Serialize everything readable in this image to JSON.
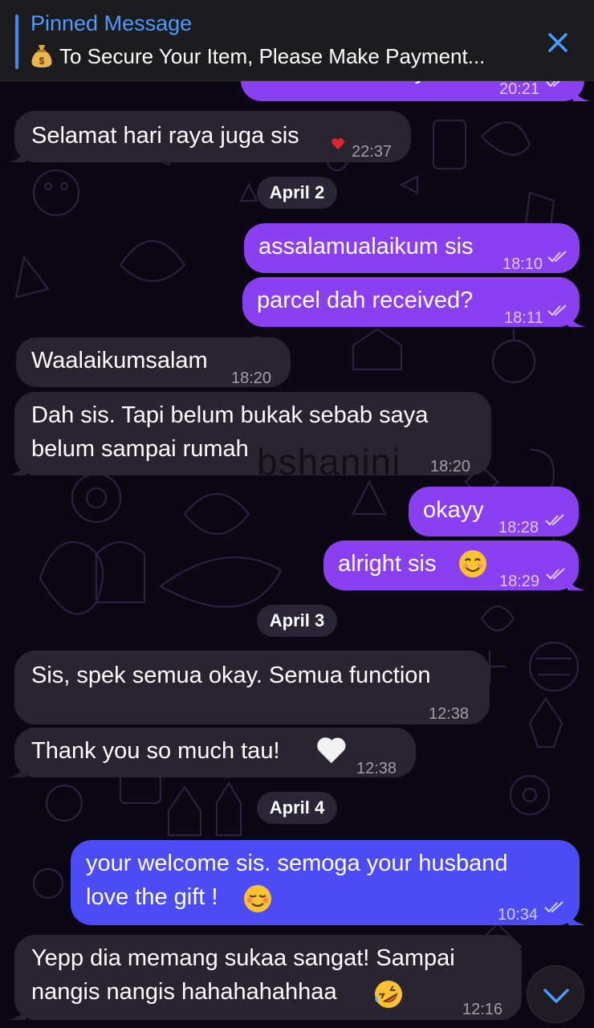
{
  "pinned": {
    "title": "Pinned Message",
    "text": "To Secure Your Item, Please Make Payment...",
    "icon": "money-bag-icon",
    "close_icon": "close-icon",
    "accent": "#4a9bff"
  },
  "colors": {
    "incoming": "#2a2430",
    "outgoing": "#8a3ff0",
    "outgoing_alt": "#4b4cf5",
    "background": "#0b0713"
  },
  "messages": {
    "m0": {
      "text": "Selamat hari raya",
      "time": "20:21"
    },
    "m1": {
      "text": "Selamat hari raya juga sis",
      "time": "22:37",
      "reaction": "heart"
    },
    "d1": "April 2",
    "m2": {
      "text": "assalamualaikum sis",
      "time": "18:10"
    },
    "m3": {
      "text": "parcel dah received?",
      "time": "18:11"
    },
    "m4": {
      "text": "Waalaikumsalam",
      "time": "18:20"
    },
    "m5": {
      "line1": "Dah sis. Tapi belum bukak sebab saya",
      "line2": "belum sampai rumah",
      "time": "18:20"
    },
    "m6": {
      "text": "okayy",
      "time": "18:28"
    },
    "m7": {
      "text": "alright sis",
      "time": "18:29",
      "emoji": "smiling-face"
    },
    "d2": "April 3",
    "m8": {
      "text": "Sis, spek semua okay. Semua function",
      "time": "12:38"
    },
    "m9": {
      "text": "Thank you so much tau!",
      "time": "12:38",
      "emoji": "white-heart"
    },
    "d3": "April 4",
    "m10": {
      "line1": "your welcome sis. semoga your husband",
      "line2": "love the gift !",
      "time": "10:34",
      "emoji": "relieved-face"
    },
    "m11": {
      "line1": "Yepp dia memang sukaa sangat! Sampai",
      "line2": "nangis nangis hahahahahhaa",
      "time": "12:16",
      "emoji": "rolling-laughing-face"
    }
  },
  "watermark": "bshanini",
  "scroll_icon": "chevron-down-icon"
}
